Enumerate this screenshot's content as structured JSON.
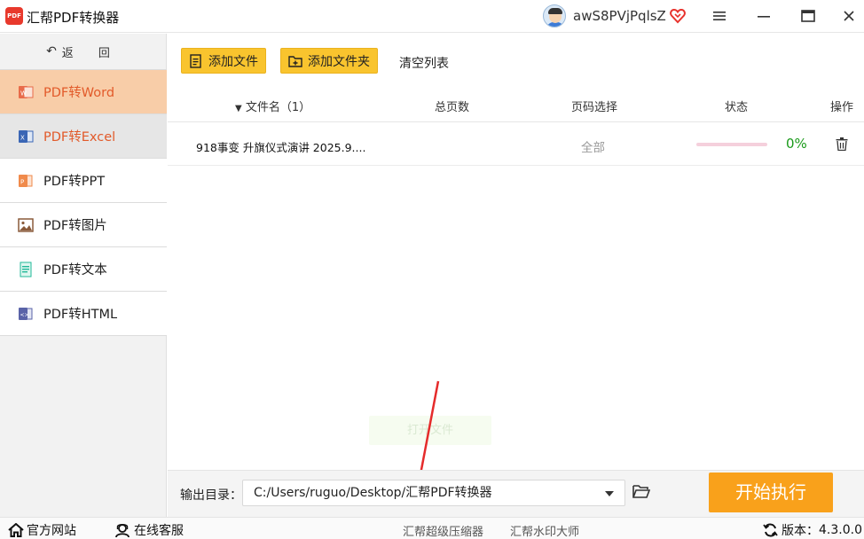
{
  "app": {
    "title": "汇帮PDF转换器",
    "logo_text": "PDF"
  },
  "user": {
    "name": "awS8PVjPqlsZ",
    "vip_icon": "heart-diamond-icon",
    "avatar_icon": "user-avatar-icon"
  },
  "window": {
    "menu": "menu-icon",
    "minimize": "minimize-icon",
    "maximize": "maximize-icon",
    "close": "close-icon"
  },
  "sidebar": {
    "back_label": "返 回",
    "items": [
      {
        "label": "PDF转Word",
        "icon": "word-icon",
        "state": "active"
      },
      {
        "label": "PDF转Excel",
        "icon": "excel-icon",
        "state": "hover"
      },
      {
        "label": "PDF转PPT",
        "icon": "ppt-icon",
        "state": "normal"
      },
      {
        "label": "PDF转图片",
        "icon": "image-icon",
        "state": "normal"
      },
      {
        "label": "PDF转文本",
        "icon": "text-icon",
        "state": "normal"
      },
      {
        "label": "PDF转HTML",
        "icon": "html-icon",
        "state": "normal"
      }
    ]
  },
  "toolbar": {
    "add_file": "添加文件",
    "add_folder": "添加文件夹",
    "clear_list": "清空列表"
  },
  "table": {
    "headers": {
      "filename": "文件名（1）",
      "pages": "总页数",
      "page_select": "页码选择",
      "status": "状态",
      "action": "操作"
    },
    "rows": [
      {
        "filename": "918事变 升旗仪式演讲 2025.9....",
        "pages": "",
        "page_select": "全部",
        "progress": 0,
        "progress_label": "0%"
      }
    ]
  },
  "ghost_button": "打开文件",
  "output": {
    "label": "输出目录：",
    "path": "C:/Users/ruguo/Desktop/汇帮PDF转换器",
    "start": "开始执行"
  },
  "footer": {
    "website": "官方网站",
    "support": "在线客服",
    "link1": "汇帮超级压缩器",
    "link2": "汇帮水印大师",
    "version_label": "版本：",
    "version": "4.3.0.0"
  },
  "colors": {
    "accent": "#f9a11b",
    "toolbar": "#f9c42e",
    "active_nav_bg": "#f8cda8",
    "active_nav_text": "#e25a2a",
    "progress": "#e33366",
    "percent": "#1a9a1a"
  }
}
